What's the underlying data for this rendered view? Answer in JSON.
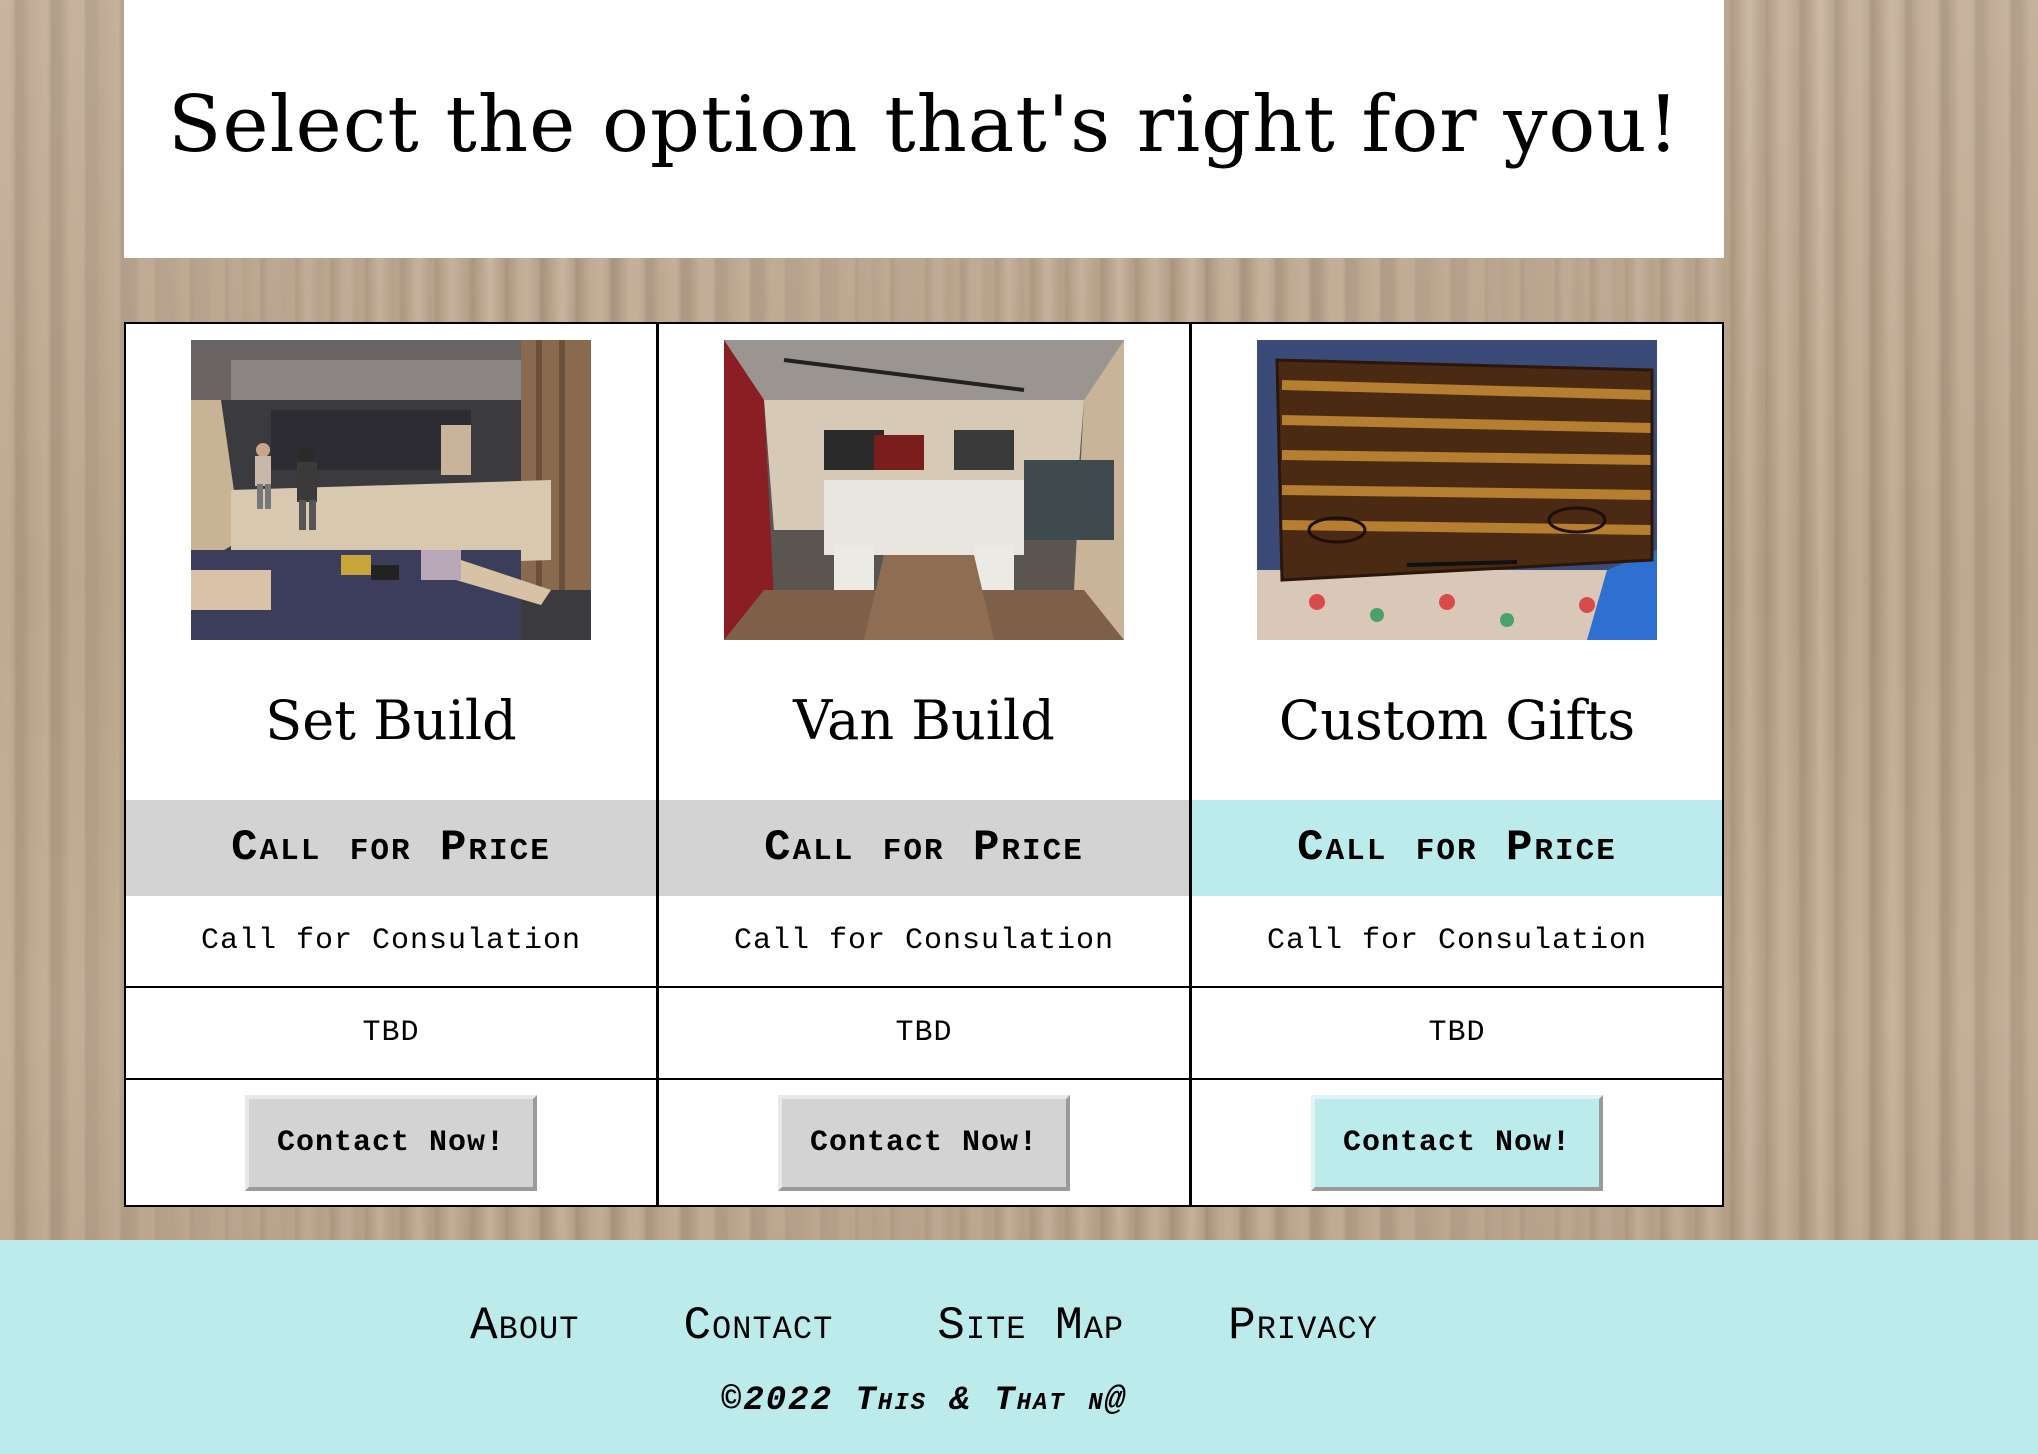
{
  "header": {
    "title": "Select the option that's right for you!"
  },
  "cards": [
    {
      "name": "Set Build",
      "price": "Call for Price",
      "description": "Call for Consulation",
      "detail": "TBD",
      "button_label": "Contact Now!",
      "accent": false
    },
    {
      "name": "Van Build",
      "price": "Call for Price",
      "description": "Call for Consulation",
      "detail": "TBD",
      "button_label": "Contact Now!",
      "accent": false
    },
    {
      "name": "Custom Gifts",
      "price": "Call for Price",
      "description": "Call for Consulation",
      "detail": "TBD",
      "button_label": "Contact Now!",
      "accent": true
    }
  ],
  "footer": {
    "nav": [
      "About",
      "Contact",
      "Site Map",
      "Privacy"
    ],
    "copyright": "©2022 This & That n@"
  },
  "colors": {
    "accent": "#bcebeb",
    "neutral": "#d3d3d3"
  }
}
